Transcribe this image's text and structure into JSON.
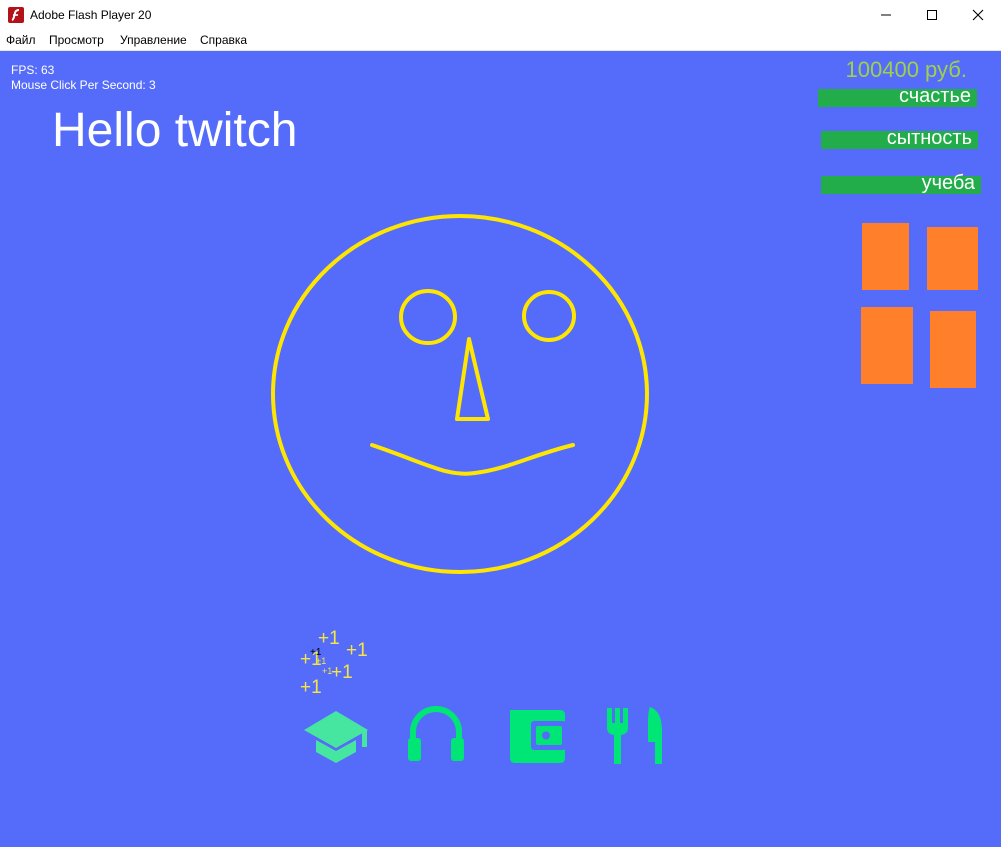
{
  "window": {
    "title": "Adobe Flash Player 20"
  },
  "menu": [
    "Файл",
    "Просмотр",
    "Управление",
    "Справка"
  ],
  "hud": {
    "fps": "FPS: 63",
    "clicks": "Mouse Click Per Second: 3",
    "money": "100400 руб."
  },
  "greeting": "Hello twitch",
  "stats": [
    {
      "label": "счастье"
    },
    {
      "label": "сытность"
    },
    {
      "label": "учеба"
    }
  ],
  "popups": [
    "+1",
    "+1",
    "+1",
    "+1",
    "+1",
    "+1",
    "+1",
    "+1"
  ],
  "actions": [
    {
      "name": "graduation-cap-icon"
    },
    {
      "name": "headphones-icon"
    },
    {
      "name": "wallet-icon"
    },
    {
      "name": "fork-knife-icon"
    }
  ],
  "colors": {
    "stage": "#556cfb",
    "face": "#ffe600",
    "money": "#9fd04b",
    "stat_bar": "#22ad4a",
    "blocks": "#ff7f2a",
    "action_icons": "#00e676",
    "plus_one": "#f5e542"
  }
}
